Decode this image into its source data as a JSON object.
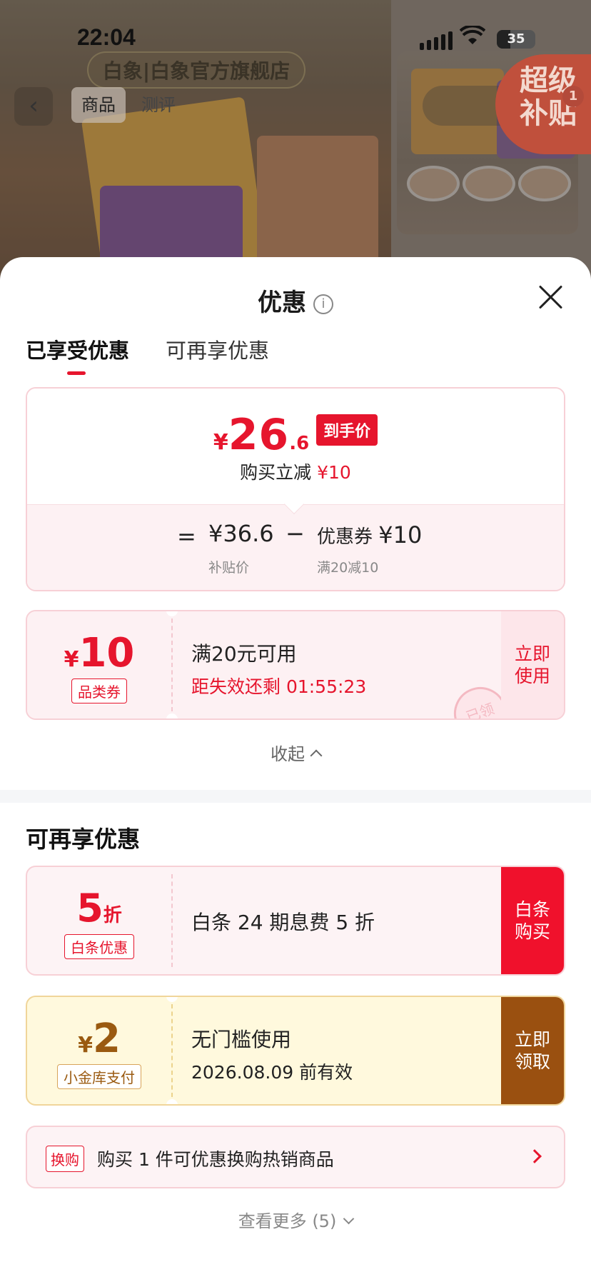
{
  "status_bar": {
    "time": "22:04",
    "battery": "35"
  },
  "background": {
    "store_name": "白象|白象官方旗舰店",
    "nav_tabs": [
      "商品",
      "测评"
    ],
    "super_badge": {
      "line1": "超级",
      "line2": "补贴",
      "count": "1"
    }
  },
  "sheet": {
    "title": "优惠",
    "tabs": [
      "已享受优惠",
      "可再享优惠"
    ],
    "price": {
      "currency": "¥",
      "integer": "26",
      "decimal": ".6",
      "tag": "到手价",
      "instant_label": "购买立减",
      "instant_value": "¥10"
    },
    "calc": {
      "equals": "=",
      "subsidy_value": "¥36.6",
      "subsidy_label": "补贴价",
      "minus": "−",
      "coupon_label": "优惠券",
      "coupon_value": "¥10",
      "coupon_rule": "满20减10"
    },
    "applied_coupon": {
      "symbol": "¥",
      "amount": "10",
      "type": "品类券",
      "condition": "满20元可用",
      "countdown": "距失效还剩 01:55:23",
      "action": "立即使用",
      "stamp": "已领"
    },
    "collapse_label": "收起",
    "more_section_title": "可再享优惠",
    "offers": [
      {
        "amount": "5",
        "unit": "折",
        "type": "白条优惠",
        "desc": "白条 24 期息费 5 折",
        "action": "白条购买"
      },
      {
        "symbol": "¥",
        "amount": "2",
        "type": "小金库支付",
        "desc": "无门槛使用",
        "expiry": "2026.08.09 前有效",
        "action": "立即领取"
      }
    ],
    "swap": {
      "badge": "换购",
      "text": "购买 1 件可优惠换购热销商品"
    },
    "see_more": "查看更多 (5)"
  },
  "colors": {
    "accent_red": "#e6152d",
    "gold": "#9a5010"
  }
}
